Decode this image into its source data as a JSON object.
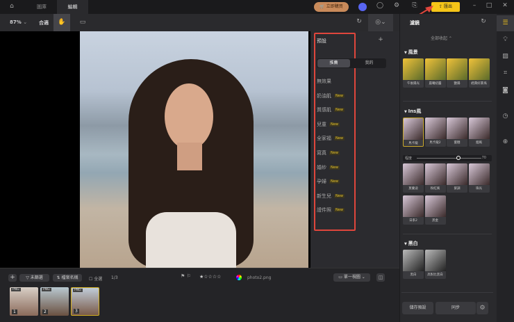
{
  "topbar": {
    "tabs": [
      {
        "label": "圖庫"
      },
      {
        "label": "編輯"
      }
    ],
    "buy_label": "立即購買",
    "export_label": "匯出"
  },
  "toolbar": {
    "zoom": "87%",
    "fit_label": "合適"
  },
  "presets": {
    "title": "預設",
    "tabs": [
      "推薦",
      "我的"
    ],
    "items": [
      {
        "label": "無效果",
        "new": false
      },
      {
        "label": "奶油肌",
        "new": true
      },
      {
        "label": "質感肌",
        "new": true
      },
      {
        "label": "兒童",
        "new": true
      },
      {
        "label": "全家福",
        "new": true
      },
      {
        "label": "寫真",
        "new": true
      },
      {
        "label": "婚紗",
        "new": true
      },
      {
        "label": "孕婦",
        "new": true
      },
      {
        "label": "新生兒",
        "new": true
      },
      {
        "label": "證件照",
        "new": true
      }
    ],
    "new_badge": "New"
  },
  "filters": {
    "title": "濾鏡",
    "collapse_all": "全部收起",
    "sections": [
      {
        "name": "風景",
        "items": [
          "午後陽光",
          "晨曦初露",
          "艷陽",
          "經典好萊塢"
        ]
      },
      {
        "name": "Ins風",
        "items": [
          "馬卡龍",
          "馬卡龍2",
          "蜜糖",
          "烟風",
          "莫蘭迪",
          "粉紅風",
          "紫調",
          "珠光",
          "日系2",
          "黑金"
        ]
      },
      {
        "name": "黑白",
        "items": [
          "黑白",
          "高對比黑白"
        ]
      }
    ],
    "strength_label": "程度",
    "strength_value": "70",
    "save_label": "儲存預設",
    "sync_label": "同步"
  },
  "bottom": {
    "filter_label": "未篩選",
    "sort_label": "檔案名稱",
    "select_all": "全選",
    "count": "1/3",
    "rating": 1,
    "filename": "photo2.png",
    "view_label": "單一視圖",
    "thumbs": [
      {
        "badge": "PNG",
        "num": "1"
      },
      {
        "badge": "PNG",
        "num": "2"
      },
      {
        "badge": "PNG",
        "num": "3"
      }
    ]
  },
  "colors": {
    "accent": "#f5c518",
    "highlight": "#e0463c"
  }
}
